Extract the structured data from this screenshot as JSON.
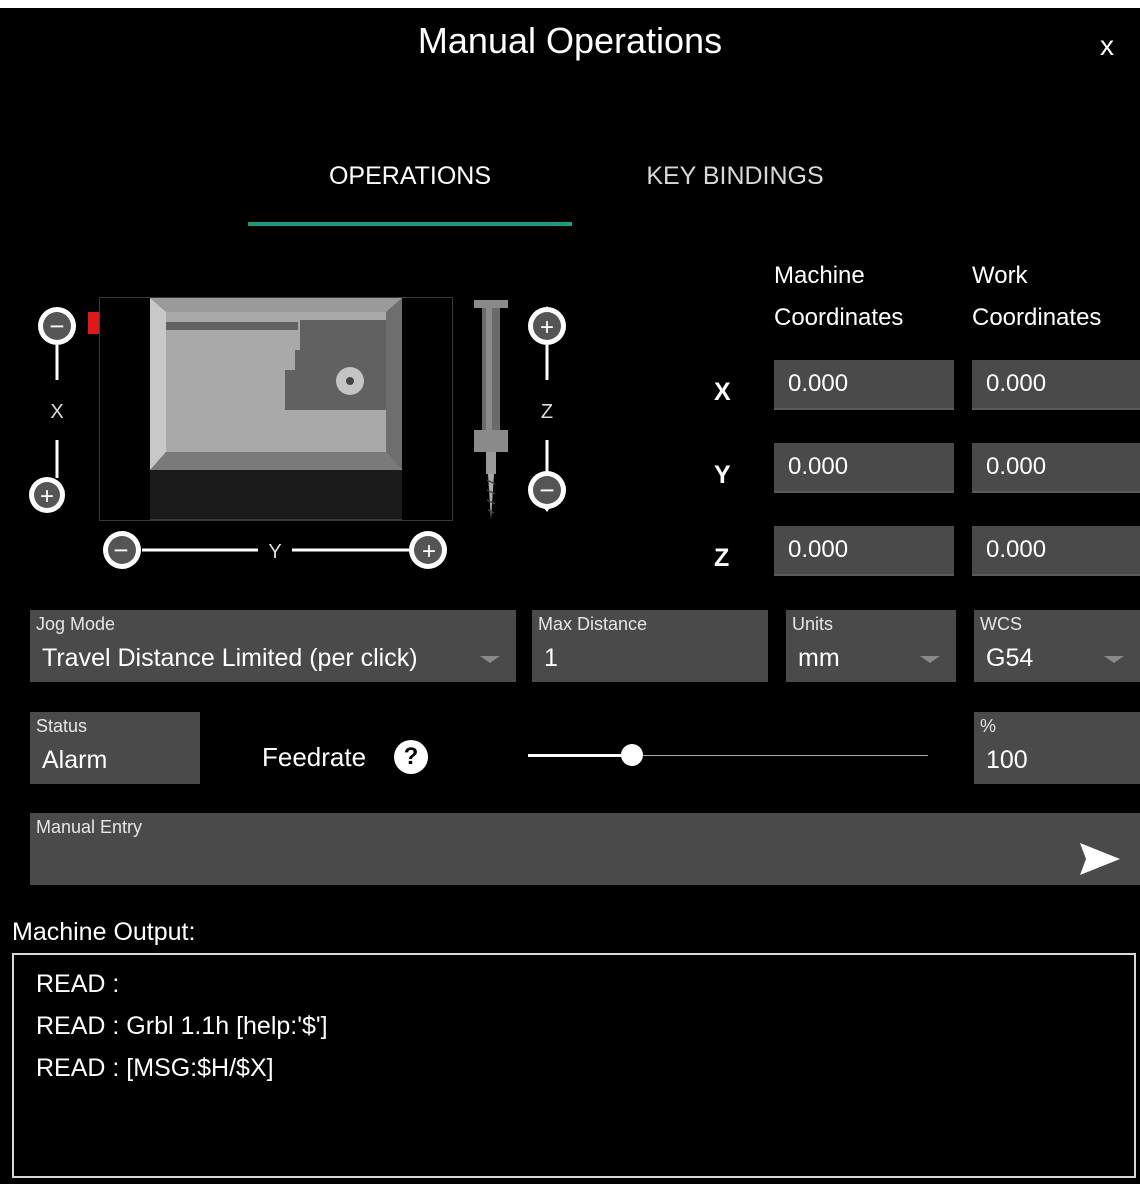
{
  "title": "Manual Operations",
  "close_label": "x",
  "tabs": [
    {
      "label": "OPERATIONS",
      "active": true
    },
    {
      "label": "KEY BINDINGS",
      "active": false
    }
  ],
  "accent_color": "#1f9a7f",
  "jog_panel": {
    "x_axis_label": "X",
    "y_axis_label": "Y",
    "z_axis_label": "Z",
    "plus": "+",
    "minus": "−",
    "limit_marker_color": "#e01818"
  },
  "coordinates": {
    "machine_header": [
      "Machine",
      "Coordinates"
    ],
    "work_header": [
      "Work",
      "Coordinates"
    ],
    "rows": [
      {
        "axis": "X",
        "machine": "0.000",
        "work": "0.000"
      },
      {
        "axis": "Y",
        "machine": "0.000",
        "work": "0.000"
      },
      {
        "axis": "Z",
        "machine": "0.000",
        "work": "0.000"
      }
    ]
  },
  "jog_mode": {
    "label": "Jog Mode",
    "value": "Travel Distance Limited (per click)"
  },
  "max_distance": {
    "label": "Max Distance",
    "value": "1"
  },
  "units": {
    "label": "Units",
    "value": "mm"
  },
  "wcs": {
    "label": "WCS",
    "value": "G54"
  },
  "status": {
    "label": "Status",
    "value": "Alarm"
  },
  "feedrate": {
    "label": "Feedrate",
    "help_icon": "?",
    "slider_fraction": 0.26
  },
  "percent": {
    "label": "%",
    "value": "100"
  },
  "manual_entry": {
    "label": "Manual Entry",
    "value": "",
    "send_icon": "send-arrow-icon"
  },
  "output": {
    "label": "Machine Output:",
    "lines": [
      "READ :",
      "READ : Grbl 1.1h [help:'$']",
      "READ : [MSG:$H/$X]"
    ]
  }
}
